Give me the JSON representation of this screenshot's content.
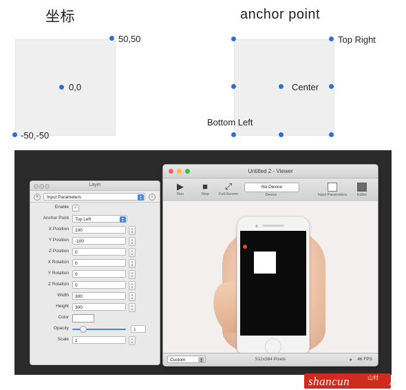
{
  "diagram": {
    "left_title": "坐标",
    "right_title": "anchor point",
    "left_labels": {
      "top_right": "50,50",
      "center": "0,0",
      "bottom_left": "-50,-50"
    },
    "right_labels": {
      "top_right": "Top Right",
      "center": "Center",
      "bottom_left": "Bottom Left"
    },
    "dot_color": "#2d6fd4",
    "box_fill": "#efefef"
  },
  "layer_panel": {
    "title": "Layer",
    "parameters_popup": "Input Parameters",
    "rows": [
      {
        "label": "Enable",
        "type": "checkbox",
        "value": "✓"
      },
      {
        "label": "Anchor Point",
        "type": "popup",
        "value": "Top Left"
      },
      {
        "label": "X Position",
        "type": "field",
        "value": "100"
      },
      {
        "label": "Y Position",
        "type": "field",
        "value": "-100"
      },
      {
        "label": "Z Position",
        "type": "field",
        "value": "0"
      },
      {
        "label": "X Rotation",
        "type": "field",
        "value": "0"
      },
      {
        "label": "Y Rotation",
        "type": "field",
        "value": "0"
      },
      {
        "label": "Z Rotation",
        "type": "field",
        "value": "0"
      },
      {
        "label": "Width",
        "type": "field",
        "value": "300"
      },
      {
        "label": "Height",
        "type": "field",
        "value": "300"
      },
      {
        "label": "Color",
        "type": "color",
        "value": ""
      },
      {
        "label": "Opacity",
        "type": "slider",
        "value": "1"
      },
      {
        "label": "Scale",
        "type": "field",
        "value": "1"
      }
    ]
  },
  "viewer": {
    "title": "Untitled 2 - Viewer",
    "toolbar": {
      "run": {
        "caption": "Run",
        "icon": "play-icon"
      },
      "stop": {
        "caption": "Stop",
        "icon": "stop-icon"
      },
      "fullscreen": {
        "caption": "Full-Screen",
        "icon": "fullscreen-icon"
      },
      "device_button": "No Device",
      "device_caption": "Device",
      "input_parameters": {
        "caption": "Input Parameters",
        "icon": "panel-icon"
      },
      "editor": {
        "caption": "Editor",
        "icon": "editor-icon"
      }
    },
    "statusbar": {
      "size_popup": "Custom",
      "pixels": "512x384 Pixels",
      "fps": "46 FPS",
      "fps_icon": "gauge-icon"
    }
  },
  "watermark": {
    "text": "shancun",
    "suffix": ".net",
    "cn": "山村"
  }
}
